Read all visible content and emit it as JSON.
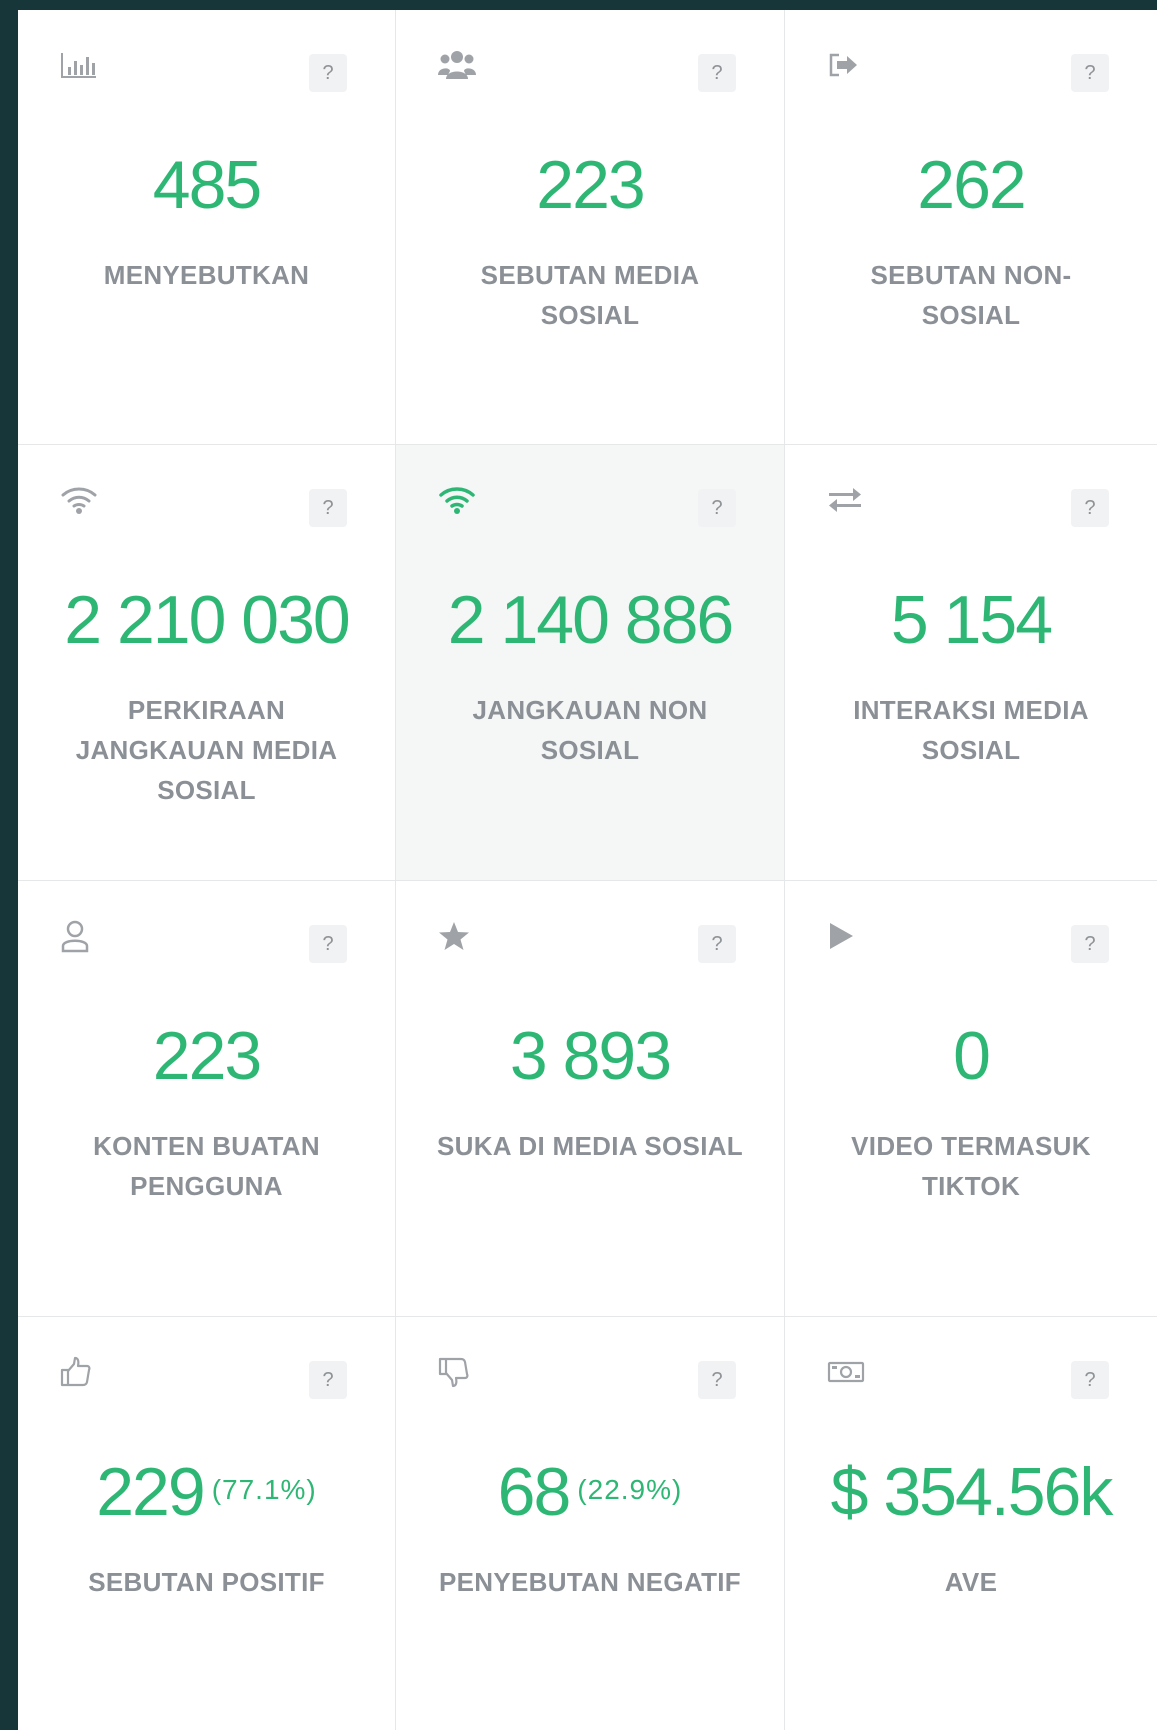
{
  "help_glyph": "?",
  "accent_color": "#2eb774",
  "tiles": [
    {
      "icon": "bar-chart-icon",
      "value": "485",
      "pct": "",
      "label": "MENYEBUTKAN"
    },
    {
      "icon": "users-icon",
      "value": "223",
      "pct": "",
      "label": "SEBUTAN MEDIA SOSIAL"
    },
    {
      "icon": "sign-out-icon",
      "value": "262",
      "pct": "",
      "label": "SEBUTAN NON-SOSIAL"
    },
    {
      "icon": "wifi-icon",
      "value": "2 210 030",
      "pct": "",
      "label": "PERKIRAAN JANGKAUAN MEDIA SOSIAL"
    },
    {
      "icon": "wifi-icon",
      "value": "2 140 886",
      "pct": "",
      "label": "JANGKAUAN NON SOSIAL"
    },
    {
      "icon": "exchange-icon",
      "value": "5 154",
      "pct": "",
      "label": "INTERAKSI MEDIA SOSIAL"
    },
    {
      "icon": "user-icon",
      "value": "223",
      "pct": "",
      "label": "KONTEN BUATAN PENGGUNA"
    },
    {
      "icon": "star-icon",
      "value": "3 893",
      "pct": "",
      "label": "SUKA DI MEDIA SOSIAL"
    },
    {
      "icon": "play-icon",
      "value": "0",
      "pct": "",
      "label": "VIDEO TERMASUK TIKTOK"
    },
    {
      "icon": "thumbs-up-icon",
      "value": "229",
      "pct": "(77.1%)",
      "label": "SEBUTAN POSITIF"
    },
    {
      "icon": "thumbs-down-icon",
      "value": "68",
      "pct": "(22.9%)",
      "label": "PENYEBUTAN NEGATIF"
    },
    {
      "icon": "money-icon",
      "value": "$ 354.56k",
      "pct": "",
      "label": "AVE"
    }
  ]
}
